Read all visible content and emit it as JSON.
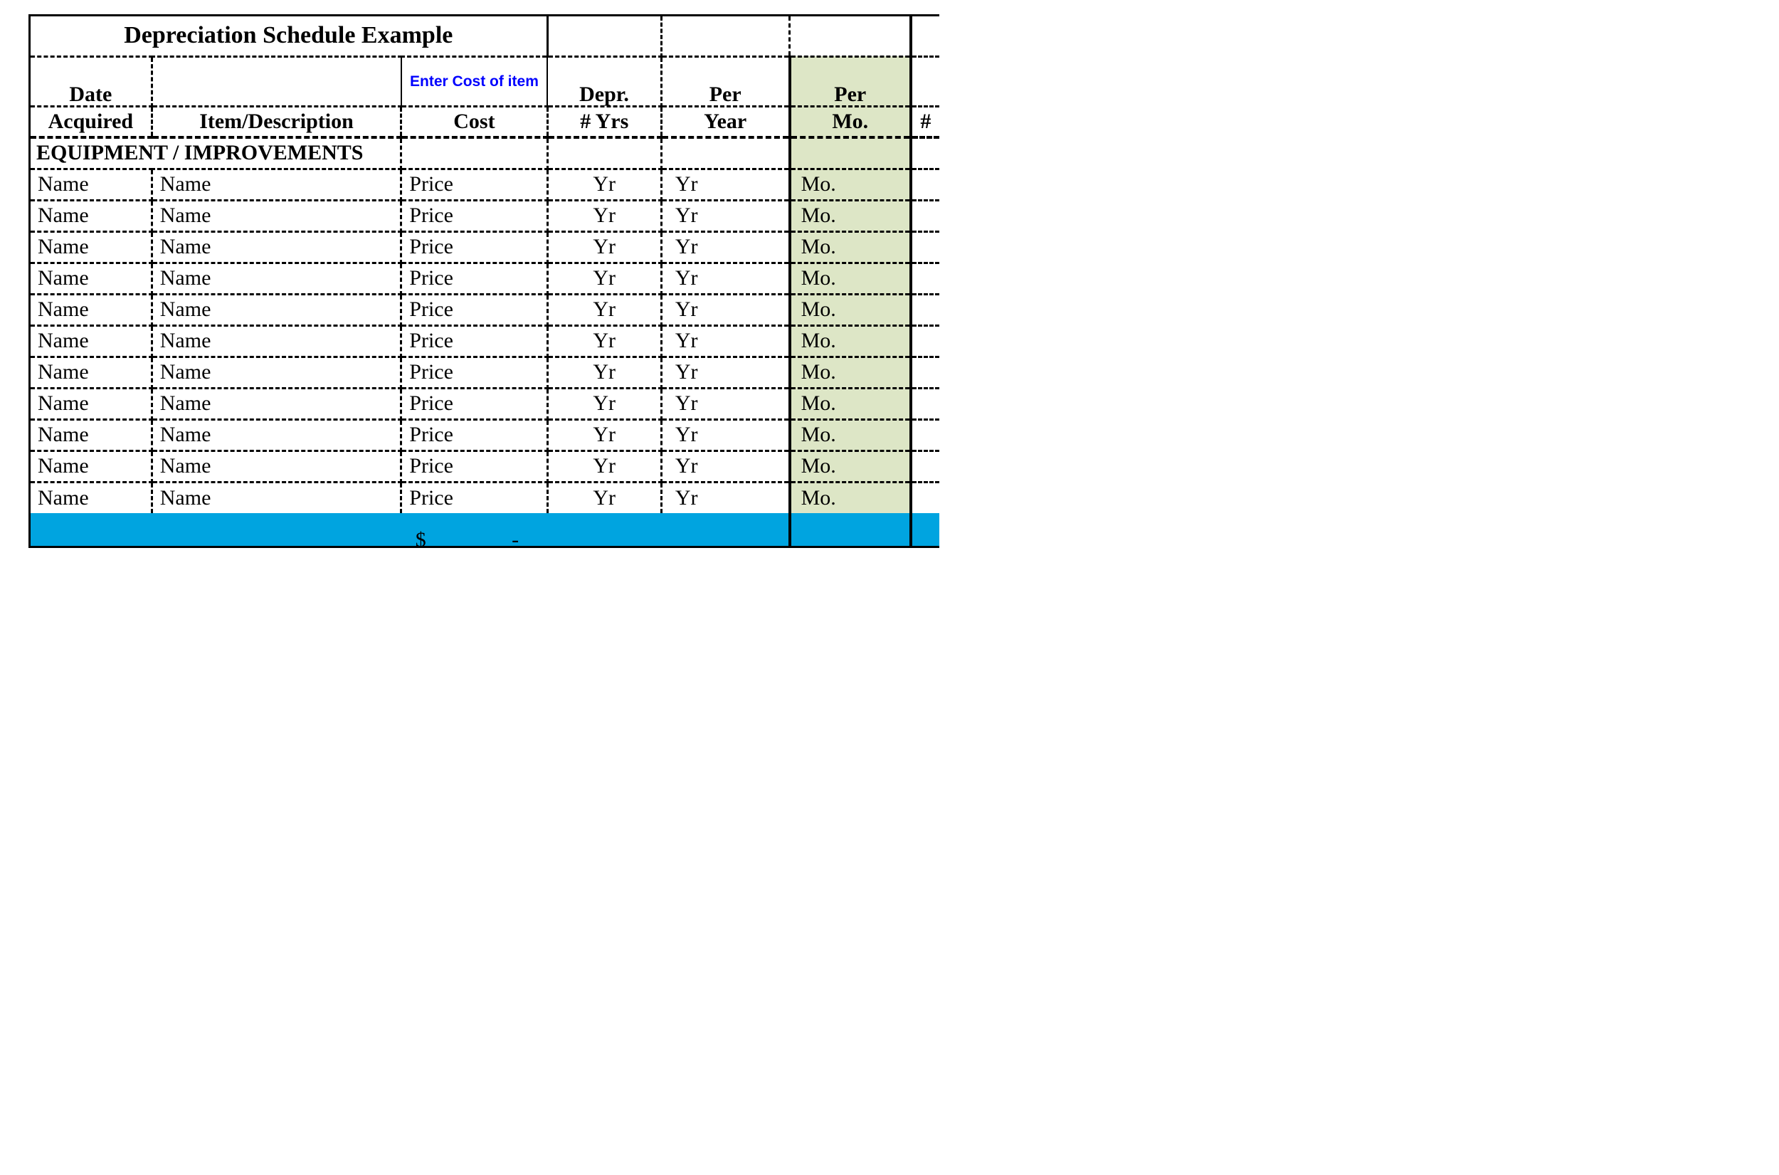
{
  "title": "Depreciation Schedule Example",
  "hint": "Enter Cost of item",
  "headers": {
    "date_top": "Date",
    "date_bot": "Acquired",
    "desc": "Item/Description",
    "cost": "Cost",
    "depr_top": "Depr.",
    "depr_bot": "# Yrs",
    "per_top": "Per",
    "per_bot": "Year",
    "mo_top": "Per",
    "mo_bot": "Mo.",
    "hash": "#"
  },
  "section": "EQUIPMENT / IMPROVEMENTS",
  "rows": [
    {
      "date": "Name",
      "desc": "Name",
      "cost": "Price",
      "depr": "Yr",
      "year": "Yr",
      "mo": "Mo."
    },
    {
      "date": "Name",
      "desc": "Name",
      "cost": "Price",
      "depr": "Yr",
      "year": "Yr",
      "mo": "Mo."
    },
    {
      "date": "Name",
      "desc": "Name",
      "cost": "Price",
      "depr": "Yr",
      "year": "Yr",
      "mo": "Mo."
    },
    {
      "date": "Name",
      "desc": "Name",
      "cost": "Price",
      "depr": "Yr",
      "year": "Yr",
      "mo": "Mo."
    },
    {
      "date": "Name",
      "desc": "Name",
      "cost": "Price",
      "depr": "Yr",
      "year": "Yr",
      "mo": "Mo."
    },
    {
      "date": "Name",
      "desc": "Name",
      "cost": "Price",
      "depr": "Yr",
      "year": "Yr",
      "mo": "Mo."
    },
    {
      "date": "Name",
      "desc": "Name",
      "cost": "Price",
      "depr": "Yr",
      "year": "Yr",
      "mo": "Mo."
    },
    {
      "date": "Name",
      "desc": "Name",
      "cost": "Price",
      "depr": "Yr",
      "year": "Yr",
      "mo": "Mo."
    },
    {
      "date": "Name",
      "desc": "Name",
      "cost": "Price",
      "depr": "Yr",
      "year": "Yr",
      "mo": "Mo."
    },
    {
      "date": "Name",
      "desc": "Name",
      "cost": "Price",
      "depr": "Yr",
      "year": "Yr",
      "mo": "Mo."
    },
    {
      "date": "Name",
      "desc": "Name",
      "cost": "Price",
      "depr": "Yr",
      "year": "Yr",
      "mo": "Mo."
    }
  ],
  "total": {
    "currency": "$",
    "value": "-"
  }
}
